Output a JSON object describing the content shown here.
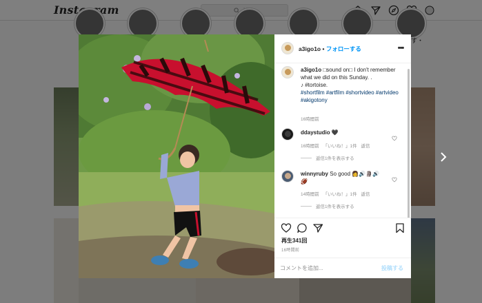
{
  "app": {
    "logo": "Instagram"
  },
  "search": {
    "placeholder": "検索"
  },
  "nav": {
    "icons": [
      "home-icon",
      "direct-icon",
      "explore-icon",
      "activity-icon",
      "profile-icon"
    ]
  },
  "background": {
    "side_caption": "す・"
  },
  "post": {
    "username": "a3igo1o",
    "separator": "•",
    "follow_label": "フォローする",
    "more_label": "•••",
    "caption_text": "□sound on□ I don't remember what we did on this Sunday. . ",
    "caption_music": "♪ #tortoise.",
    "hashtags": "#shortfilm #artfilm #shortvideo #artvideo #akigotony",
    "caption_time": "16時間前"
  },
  "comments": [
    {
      "username": "ddaystudio",
      "text": "🖤",
      "time": "16時間前",
      "likes": "「いいね！」1件",
      "reply_label": "返信",
      "view_replies": "返信1件を表示する"
    },
    {
      "username": "winnyruby",
      "text": "So good 👩🔊🗿🔊",
      "text2": "🏈",
      "time": "14時間前",
      "likes": "「いいね！」1件",
      "reply_label": "返信",
      "view_replies": "返信1件を表示する"
    }
  ],
  "stats": {
    "views": "再生341回",
    "ago": "16時間前"
  },
  "comment_box": {
    "placeholder": "コメントを追加...",
    "post_label": "投稿する"
  },
  "colors": {
    "accent": "#0095f6",
    "post_disabled": "#b2dffc",
    "umbrella": "#c8102e"
  }
}
